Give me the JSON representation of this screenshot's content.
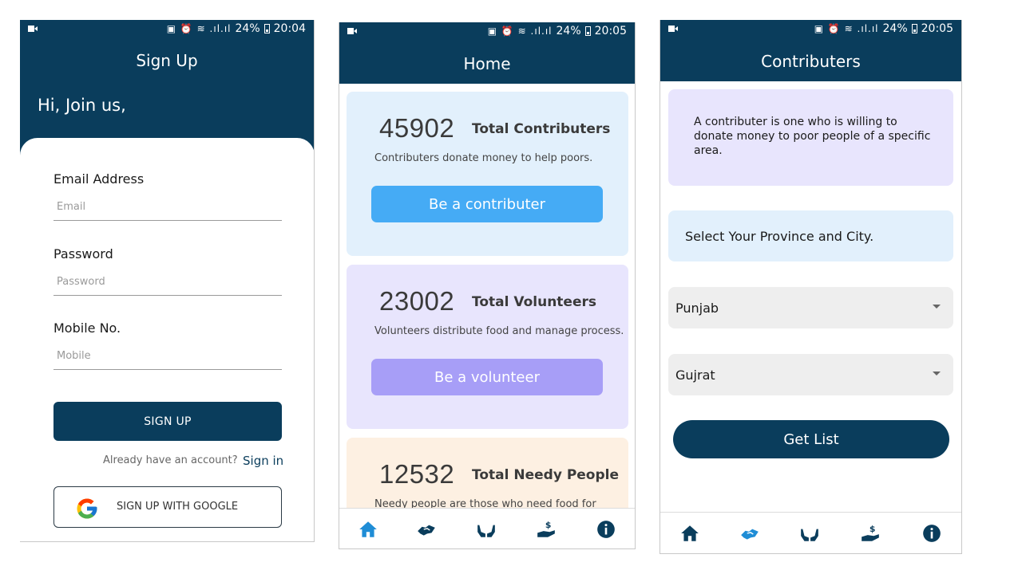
{
  "colors": {
    "primary": "#0a3d5c",
    "contributer_card_bg": "#e2f0fc",
    "contributer_btn": "#45abf5",
    "volunteer_card_bg": "#e8e5fd",
    "volunteer_btn": "#a79ef7",
    "needy_card_bg": "#fdf0e2",
    "nav_active": "#1f8dd6"
  },
  "status_bar": {
    "signup": {
      "battery": "24%",
      "time": "20:04"
    },
    "home": {
      "battery": "24%",
      "time": "20:05"
    },
    "contributers": {
      "battery": "24%",
      "time": "20:05"
    }
  },
  "signup": {
    "title": "Sign Up",
    "greeting": "Hi, Join us,",
    "email_label": "Email Address",
    "email_placeholder": "Email",
    "password_label": "Password",
    "password_placeholder": "Password",
    "mobile_label": "Mobile No.",
    "mobile_placeholder": "Mobile",
    "signup_button": "SIGN UP",
    "already_text": "Already have an account?",
    "signin_link": "Sign in",
    "google_button": "SIGN UP WITH GOOGLE"
  },
  "home": {
    "title": "Home",
    "cards": [
      {
        "number": "45902",
        "title": "Total Contributers",
        "description": "Contributers donate money to help poors.",
        "button": "Be a contributer"
      },
      {
        "number": "23002",
        "title": "Total Volunteers",
        "description": "Volunteers distribute food and manage process.",
        "button": "Be a volunteer"
      },
      {
        "number": "12532",
        "title": "Total Needy People",
        "description": "Needy people are those who need food for"
      }
    ]
  },
  "contributers": {
    "title": "Contributers",
    "info_text": "A contributer is one who is willing to donate money to poor people of a specific area.",
    "select_text": "Select Your Province and City.",
    "province_value": "Punjab",
    "city_value": "Gujrat",
    "get_list_button": "Get List"
  },
  "bottom_nav": {
    "items": [
      {
        "icon": "home-icon"
      },
      {
        "icon": "handshake-icon"
      },
      {
        "icon": "open-hands-icon"
      },
      {
        "icon": "donate-hand-icon"
      },
      {
        "icon": "info-icon"
      }
    ]
  }
}
